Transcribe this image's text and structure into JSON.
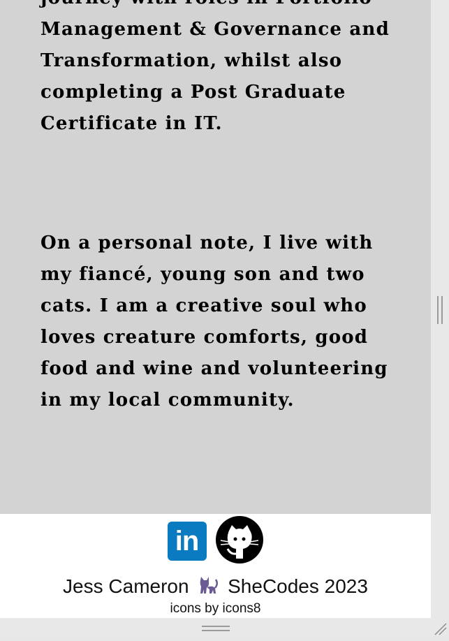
{
  "about": {
    "paragraph1": "journey with roles in Portfolio Management & Governance and Transformation, whilst also completing a Post Graduate Certificate in IT.",
    "paragraph2": "On a personal note, I live with my fiancé, young son and two cats. I am a creative soul who loves creature comforts, good food and wine and volunteering in my local community."
  },
  "footer": {
    "linkedin_icon_text": "in",
    "credit_name": "Jess Cameron",
    "credit_org": "SheCodes 2023",
    "icons_credit": "icons by icons8"
  },
  "colors": {
    "about_background": "#d3d3d3",
    "linkedin_blue": "#0a7bc1",
    "cat_purple": "#6b5b95"
  },
  "icons": [
    "linkedin-icon",
    "github-icon",
    "cat-icon"
  ]
}
